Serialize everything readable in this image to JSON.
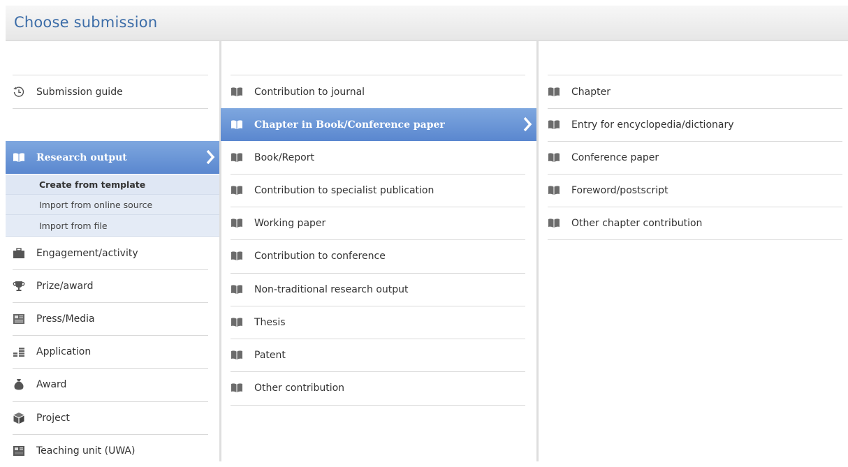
{
  "header": {
    "title": "Choose submission"
  },
  "left": {
    "guide": {
      "label": "Submission guide",
      "icon": "history-clock-icon"
    },
    "active": {
      "label": "Research output",
      "icon": "open-book-icon"
    },
    "subitems": [
      {
        "label": "Create from template",
        "current": true
      },
      {
        "label": "Import from online source"
      },
      {
        "label": "Import from file"
      }
    ],
    "items": [
      {
        "label": "Engagement/activity",
        "icon": "briefcase-icon"
      },
      {
        "label": "Prize/award",
        "icon": "trophy-icon"
      },
      {
        "label": "Press/Media",
        "icon": "newspaper-icon"
      },
      {
        "label": "Application",
        "icon": "money-stack-icon"
      },
      {
        "label": "Award",
        "icon": "money-bag-icon"
      },
      {
        "label": "Project",
        "icon": "cube-icon"
      },
      {
        "label": "Teaching unit (UWA)",
        "icon": "film-board-icon"
      }
    ]
  },
  "middle": {
    "items": [
      {
        "label": "Contribution to journal"
      },
      {
        "label": "Chapter in Book/Conference paper",
        "active": true
      },
      {
        "label": "Book/Report"
      },
      {
        "label": "Contribution to specialist publication"
      },
      {
        "label": "Working paper"
      },
      {
        "label": "Contribution to conference"
      },
      {
        "label": "Non-traditional research output"
      },
      {
        "label": "Thesis"
      },
      {
        "label": "Patent"
      },
      {
        "label": "Other contribution"
      }
    ]
  },
  "right": {
    "items": [
      {
        "label": "Chapter"
      },
      {
        "label": "Entry for encyclopedia/dictionary"
      },
      {
        "label": "Conference paper"
      },
      {
        "label": "Foreword/postscript"
      },
      {
        "label": "Other chapter contribution"
      }
    ]
  },
  "colors": {
    "title": "#3c6da8",
    "active_top": "#7ea7df",
    "active_bottom": "#5a87cf",
    "icon": "#6b6b6b"
  }
}
